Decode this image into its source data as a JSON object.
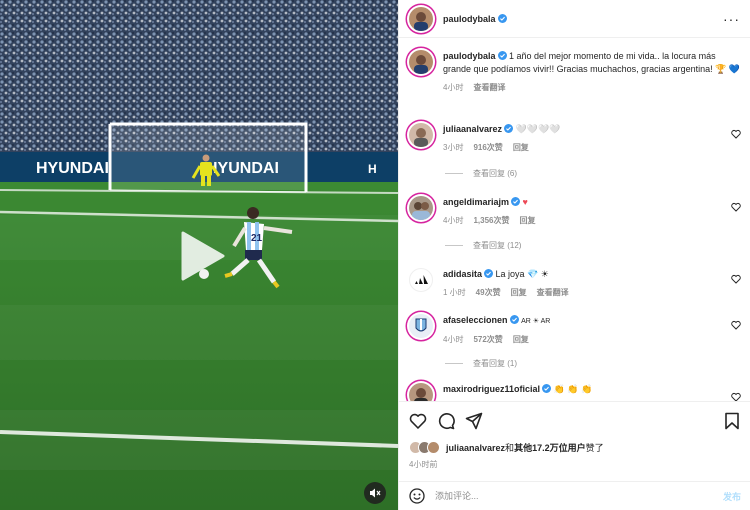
{
  "post": {
    "username": "paulodybala",
    "caption": "1 año del mejor momento de mi vida.. la locura más grande que podíamos vivir!! Gracias muchachos, gracias argentina! 🏆 💙",
    "caption_age": "4小时",
    "see_translation": "查看翻译"
  },
  "media": {
    "ad_board_1": "HYUNDAI",
    "ad_board_2": "HYUNDAI",
    "ad_board_3": "HYUNDAI",
    "player_number": "21"
  },
  "header": {
    "more_label": "···"
  },
  "comments": [
    {
      "user": "juliaanalvarez",
      "text": "🤍🤍🤍🤍",
      "age": "3小时",
      "likes": "916次赞",
      "reply": "回复",
      "view_replies": "查看回复 (6)"
    },
    {
      "user": "angeldimariajm",
      "text": "♥",
      "age": "4小时",
      "likes": "1,356次赞",
      "reply": "回复",
      "view_replies": "查看回复 (12)"
    },
    {
      "user": "adidasita",
      "text": "La joya 💎 ☀",
      "age": "1 小时",
      "likes": "49次赞",
      "reply": "回复",
      "translate": "查看翻译"
    },
    {
      "user": "afaseleccionen",
      "text": "AR ☀ AR",
      "age": "4小时",
      "likes": "572次赞",
      "reply": "回复",
      "view_replies": "查看回复 (1)"
    },
    {
      "user": "maxirodriguez11oficial",
      "text": "👏 👏 👏"
    }
  ],
  "likes_summary": {
    "user": "juliaanalvarez",
    "middle": "和",
    "others": "其他17.2万位用户",
    "suffix": "赞了"
  },
  "post_time": "4小时前",
  "composer": {
    "placeholder": "添加评论...",
    "post_label": "发布"
  },
  "colors": {
    "verified": "#3897f0",
    "heart_red": "#ed4956",
    "link_blue": "#b2dffc",
    "ring": "#d6249f"
  }
}
